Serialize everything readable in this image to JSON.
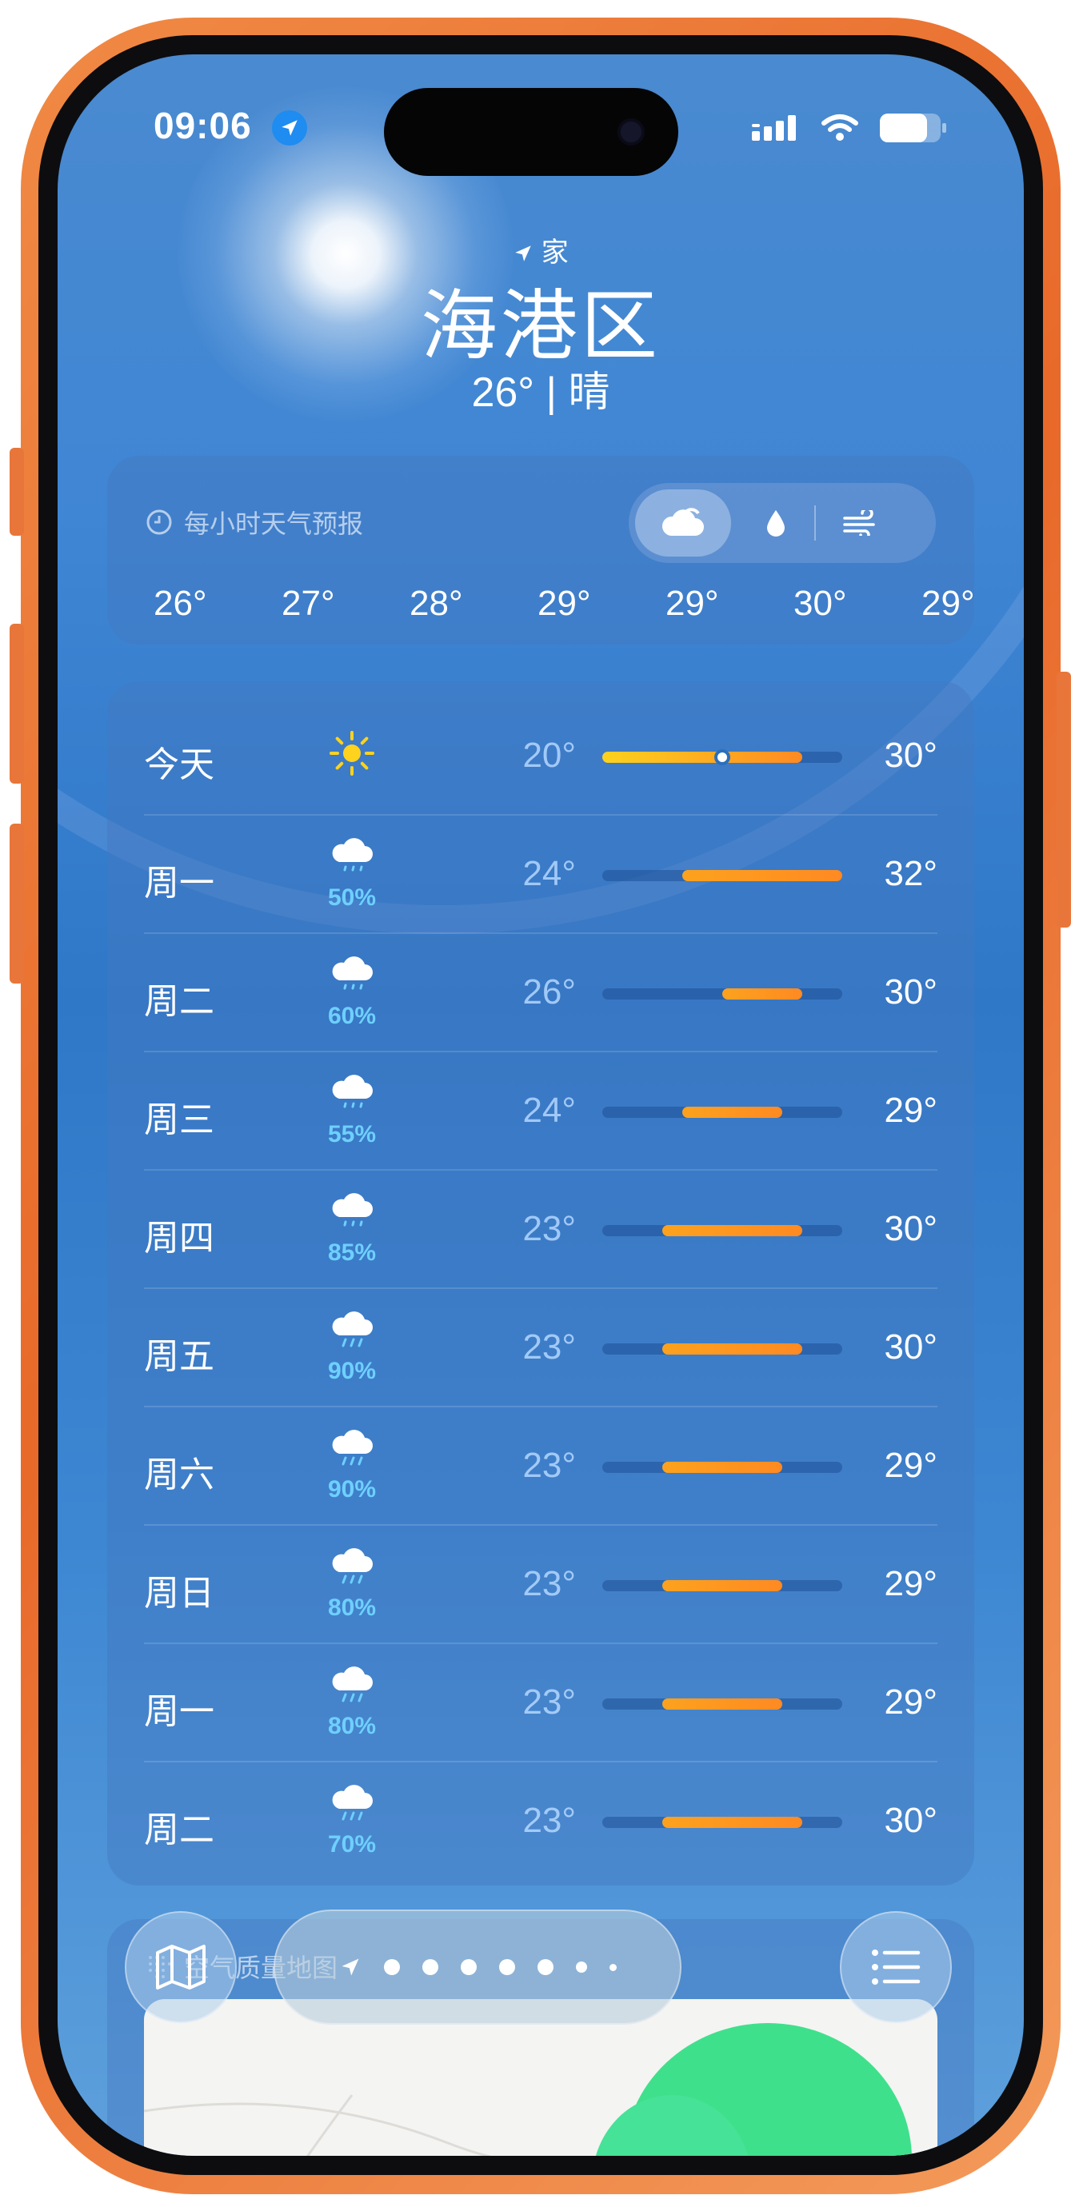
{
  "status_bar": {
    "time": "09:06"
  },
  "header": {
    "home_label": "家",
    "city": "海港区",
    "current": "26° | 晴"
  },
  "hourly": {
    "title": "每小时天气预报",
    "tabs": [
      "cloud-icon",
      "drop-icon",
      "wind-icon"
    ],
    "temps": [
      "26°",
      "27°",
      "28°",
      "29°",
      "29°",
      "30°",
      "29°"
    ]
  },
  "daily": [
    {
      "day": "今天",
      "icon": "sun-icon",
      "precip": "",
      "low": "20°",
      "high": "30°"
    },
    {
      "day": "周一",
      "icon": "rain-cloud-icon",
      "precip": "50%",
      "low": "24°",
      "high": "32°"
    },
    {
      "day": "周二",
      "icon": "rain-cloud-icon",
      "precip": "60%",
      "low": "26°",
      "high": "30°"
    },
    {
      "day": "周三",
      "icon": "rain-cloud-icon",
      "precip": "55%",
      "low": "24°",
      "high": "29°"
    },
    {
      "day": "周四",
      "icon": "rain-cloud-icon",
      "precip": "85%",
      "low": "23°",
      "high": "30°"
    },
    {
      "day": "周五",
      "icon": "heavy-rain-cloud-icon",
      "precip": "90%",
      "low": "23°",
      "high": "30°"
    },
    {
      "day": "周六",
      "icon": "heavy-rain-cloud-icon",
      "precip": "90%",
      "low": "23°",
      "high": "29°"
    },
    {
      "day": "周日",
      "icon": "heavy-rain-cloud-icon",
      "precip": "80%",
      "low": "23°",
      "high": "29°"
    },
    {
      "day": "周一",
      "icon": "heavy-rain-cloud-icon",
      "precip": "80%",
      "low": "23°",
      "high": "29°"
    },
    {
      "day": "周二",
      "icon": "heavy-rain-cloud-icon",
      "precip": "70%",
      "low": "23°",
      "high": "30°"
    }
  ],
  "air_quality": {
    "title": "空气质量地图"
  },
  "colors": {
    "accent_blue": "#1e8cf0",
    "precip_blue": "#6ed0ff",
    "temp_bar_orange": "#ff8a22",
    "temp_bar_yellow": "#fcd21e",
    "frame_orange": "#e8692a"
  }
}
